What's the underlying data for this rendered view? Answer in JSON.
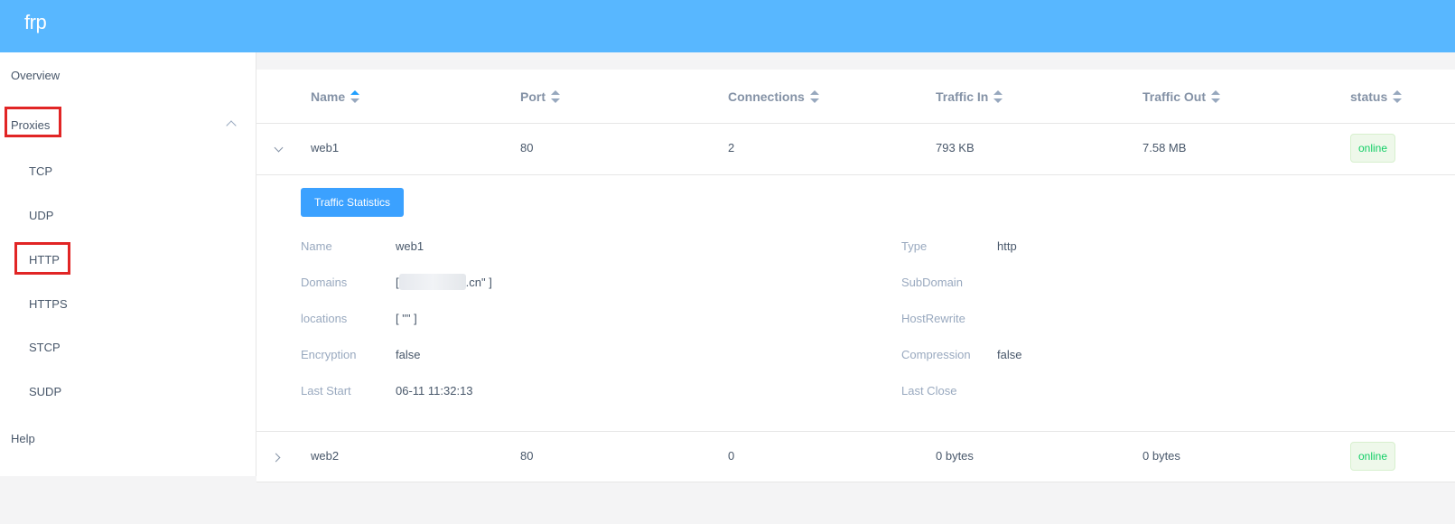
{
  "app": {
    "title": "frp"
  },
  "sidebar": {
    "overview": "Overview",
    "proxies": "Proxies",
    "sub": [
      "TCP",
      "UDP",
      "HTTP",
      "HTTPS",
      "STCP",
      "SUDP"
    ],
    "help": "Help"
  },
  "table": {
    "columns": [
      "Name",
      "Port",
      "Connections",
      "Traffic In",
      "Traffic Out",
      "status"
    ],
    "rows": [
      {
        "name": "web1",
        "port": "80",
        "connections": "2",
        "traffic_in": "793 KB",
        "traffic_out": "7.58 MB",
        "status": "online",
        "expanded": true
      },
      {
        "name": "web2",
        "port": "80",
        "connections": "0",
        "traffic_in": "0 bytes",
        "traffic_out": "0 bytes",
        "status": "online",
        "expanded": false
      }
    ]
  },
  "details": {
    "button": "Traffic Statistics",
    "left": [
      {
        "label": "Name",
        "value": "web1"
      },
      {
        "label": "Domains",
        "value_prefix": "[",
        "value_suffix": ".cn\" ]"
      },
      {
        "label": "locations",
        "value": "[ \"\" ]"
      },
      {
        "label": "Encryption",
        "value": "false"
      },
      {
        "label": "Last Start",
        "value": "06-11 11:32:13"
      }
    ],
    "right": [
      {
        "label": "Type",
        "value": "http"
      },
      {
        "label": "SubDomain",
        "value": ""
      },
      {
        "label": "HostRewrite",
        "value": ""
      },
      {
        "label": "Compression",
        "value": "false"
      },
      {
        "label": "Last Close",
        "value": ""
      }
    ]
  },
  "colors": {
    "header": "#58b7ff",
    "primary": "#3ba1ff",
    "success": "#13ce66",
    "highlight_box": "#e12525"
  }
}
